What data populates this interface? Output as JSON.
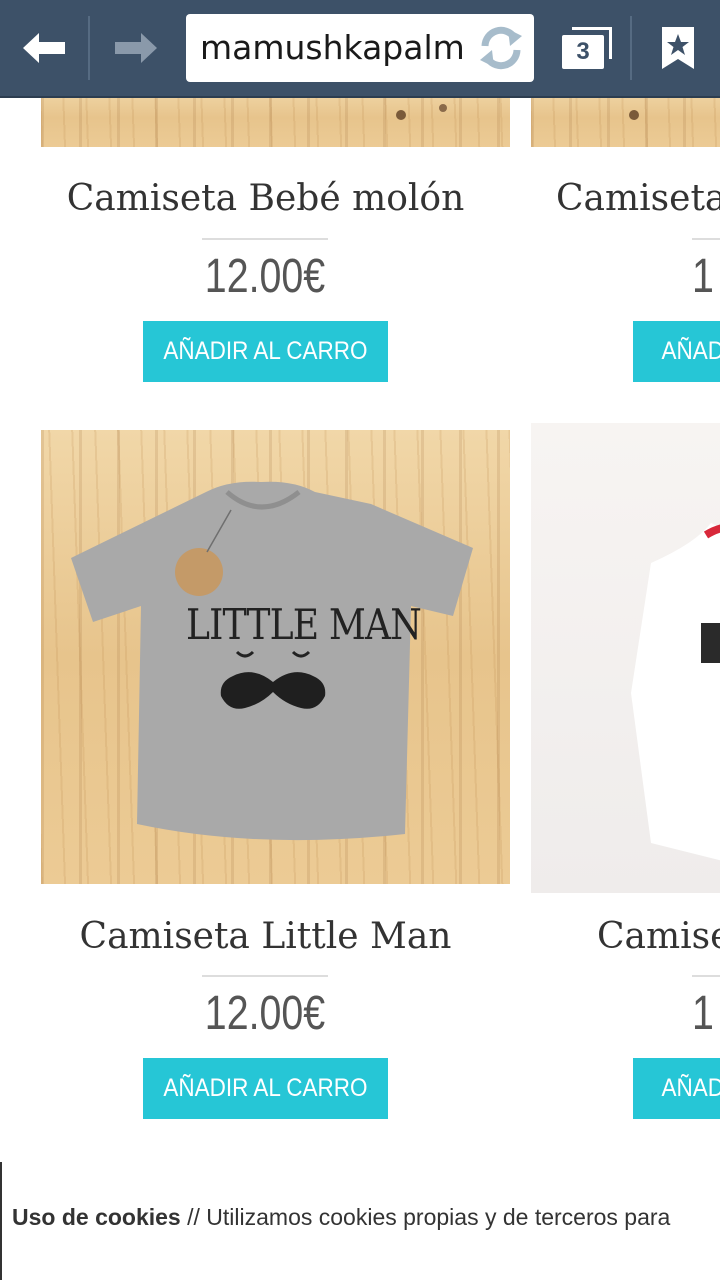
{
  "browser": {
    "url": "mamushkapalm",
    "tab_count": "3"
  },
  "products": [
    {
      "title": "Camiseta Bebé molón",
      "price": "12.00€",
      "button": "AÑADIR AL CARRO"
    },
    {
      "title": "Camiseta",
      "price": "1",
      "button": "AÑAD"
    },
    {
      "title": "Camiseta Little Man",
      "price": "12.00€",
      "button": "AÑADIR AL CARRO"
    },
    {
      "title": "Camise",
      "price": "1",
      "button": "AÑAD"
    }
  ],
  "tshirt": {
    "print_text": "LITTLE MAN",
    "color": "#a9a9a9"
  },
  "cookie_bar": {
    "heading": "Uso de cookies",
    "text": " // Utilizamos cookies propias y de terceros para"
  },
  "colors": {
    "toolbar": "#3d5168",
    "accent": "#26c6d6"
  }
}
